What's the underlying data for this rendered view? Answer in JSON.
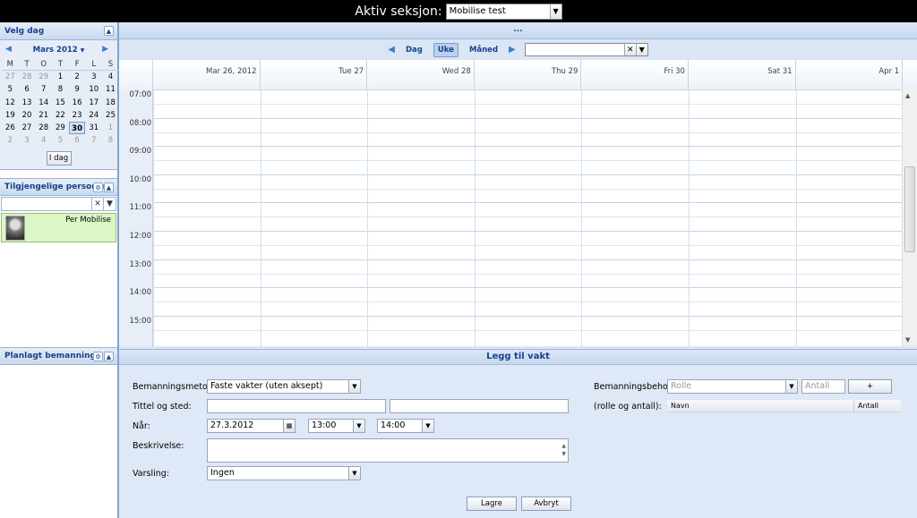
{
  "topbar": {
    "label": "Aktiv seksjon:",
    "section_value": "Mobilise test"
  },
  "left": {
    "velg_dag": "Velg dag",
    "month_title": "Mars 2012",
    "weekdays": [
      "M",
      "T",
      "O",
      "T",
      "F",
      "L",
      "S"
    ],
    "weeks": [
      [
        "27",
        "28",
        "29",
        "1",
        "2",
        "3",
        "4"
      ],
      [
        "5",
        "6",
        "7",
        "8",
        "9",
        "10",
        "11"
      ],
      [
        "12",
        "13",
        "14",
        "15",
        "16",
        "17",
        "18"
      ],
      [
        "19",
        "20",
        "21",
        "22",
        "23",
        "24",
        "25"
      ],
      [
        "26",
        "27",
        "28",
        "29",
        "30",
        "31",
        "1"
      ],
      [
        "2",
        "3",
        "4",
        "5",
        "6",
        "7",
        "8"
      ]
    ],
    "today_button": "I dag",
    "tilgjengelige": "Tilgjengelige personer",
    "person_name": "Per Mobilise",
    "planlagt": "Planlagt bemanning"
  },
  "main": {
    "dots": "...",
    "tabs": {
      "dag": "Dag",
      "uke": "Uke",
      "maned": "Måned"
    },
    "days": [
      "Mar 26, 2012",
      "Tue 27",
      "Wed 28",
      "Thu 29",
      "Fri 30",
      "Sat 31",
      "Apr 1"
    ],
    "hours": [
      "07:00",
      "08:00",
      "09:00",
      "10:00",
      "11:00",
      "12:00",
      "13:00",
      "14:00",
      "15:00"
    ]
  },
  "form": {
    "title": "Legg til vakt",
    "bemanningsmetode_label": "Bemanningsmetode:",
    "bemanningsmetode_value": "Faste vakter (uten aksept)",
    "tittel_label": "Tittel og sted:",
    "naar_label": "Når:",
    "date_value": "27.3.2012",
    "from_time": "13:00",
    "to_time": "14:00",
    "beskrivelse_label": "Beskrivelse:",
    "varsling_label": "Varsling:",
    "varsling_value": "Ingen",
    "behov_label": "Bemanningsbehov:",
    "rolle_placeholder": "Rolle",
    "antall_placeholder": "Antall",
    "add_button": "+",
    "rolle_antall_label": "(rolle og antall):",
    "col_navn": "Navn",
    "col_antall": "Antall",
    "save_button": "Lagre",
    "cancel_button": "Avbryt"
  }
}
